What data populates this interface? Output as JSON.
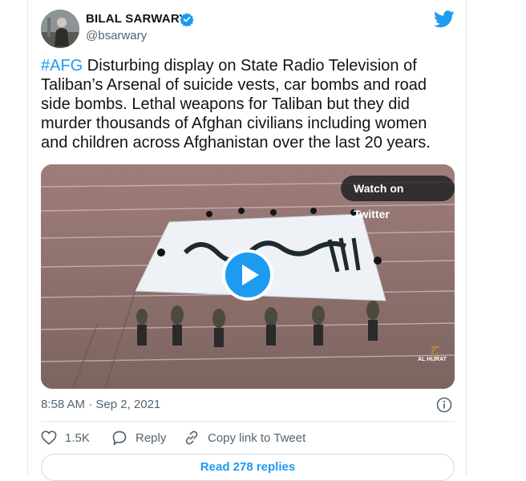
{
  "author": {
    "display_name": "BILAL SARWARY",
    "handle": "@bsarwary",
    "verified": true
  },
  "tweet": {
    "hashtag": "#AFG",
    "text": " Disturbing display on State Radio Television of Taliban’s Arsenal of suicide vests, car bombs and road side bombs. Lethal weapons for Taliban but they did murder thousands of Afghan civilians including women and children across Afghanistan over the last 20 years."
  },
  "media": {
    "watch_label": "Watch on Twitter",
    "watermark": "AL HIJRAT",
    "play_icon": "play-icon"
  },
  "meta": {
    "timestamp": "8:58 AM · Sep 2, 2021"
  },
  "actions": {
    "likes": "1.5K",
    "reply": "Reply",
    "copy_link": "Copy link to Tweet"
  },
  "replies_button": "Read 278 replies",
  "colors": {
    "accent": "#1d9bf0",
    "text": "#0f1419",
    "muted": "#536471",
    "border": "#e1e8ed"
  }
}
